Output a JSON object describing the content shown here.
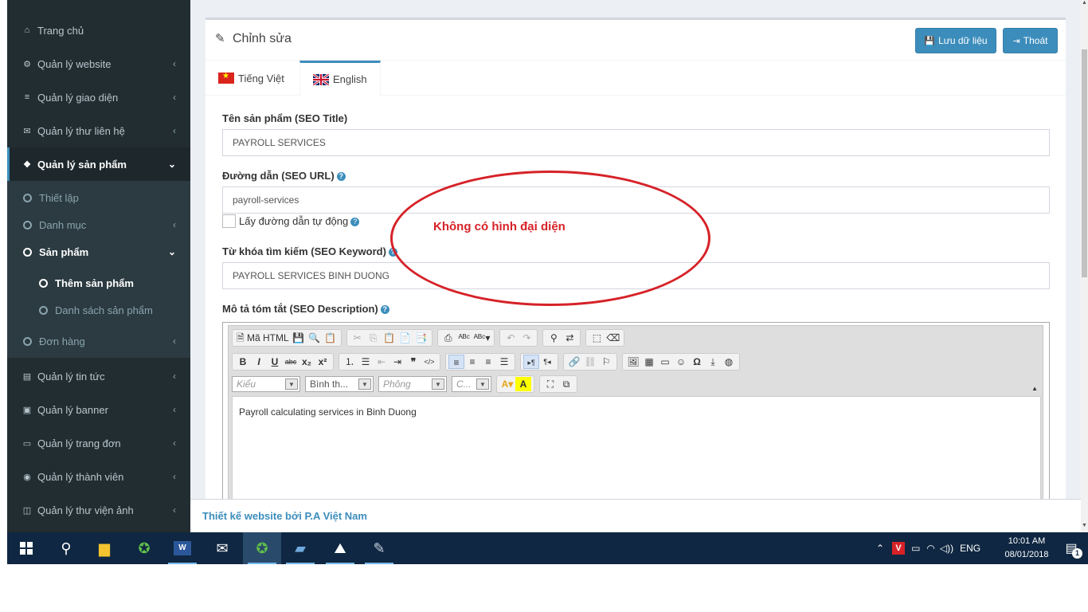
{
  "sidebar": {
    "items": [
      {
        "label": "Trang chủ",
        "icon": "home-icon"
      },
      {
        "label": "Quản lý website",
        "icon": "gears-icon"
      },
      {
        "label": "Quản lý giao diện",
        "icon": "bars-icon"
      },
      {
        "label": "Quản lý thư liên hệ",
        "icon": "envelope-icon"
      },
      {
        "label": "Quản lý sản phẩm",
        "icon": "cubes-icon"
      },
      {
        "label": "Quản lý tin tức",
        "icon": "newspaper-icon"
      },
      {
        "label": "Quản lý banner",
        "icon": "image-icon"
      },
      {
        "label": "Quản lý trang đơn",
        "icon": "laptop-icon"
      },
      {
        "label": "Quản lý thành viên",
        "icon": "user-circle-icon"
      },
      {
        "label": "Quản lý thư viện ảnh",
        "icon": "file-image-icon"
      }
    ],
    "submenu": [
      {
        "label": "Thiết lập"
      },
      {
        "label": "Danh mục"
      },
      {
        "label": "Sản phẩm"
      },
      {
        "label": "Thêm sản phẩm"
      },
      {
        "label": "Danh sách sản phẩm"
      },
      {
        "label": "Đơn hàng"
      }
    ]
  },
  "panel": {
    "title": "Chỉnh sửa",
    "save_label": "Lưu dữ liệu",
    "exit_label": "Thoát"
  },
  "tabs": [
    {
      "label": "Tiếng Việt",
      "icon": "vietnam-flag-icon"
    },
    {
      "label": "English",
      "icon": "uk-flag-icon"
    }
  ],
  "form": {
    "seo_title_label": "Tên sản phẩm (SEO Title)",
    "seo_title_value": "PAYROLL SERVICES",
    "seo_url_label": "Đường dẫn (SEO URL)",
    "seo_url_value": "payroll-services",
    "auto_url_label": "Lấy đường dẫn tự động",
    "seo_keyword_label": "Từ khóa tìm kiếm (SEO Keyword)",
    "seo_keyword_value": "PAYROLL SERVICES BINH DUONG",
    "seo_desc_label": "Mô tả tóm tắt (SEO Description)"
  },
  "editor": {
    "source_label": "Mã HTML",
    "style_combo": "Kiểu",
    "format_combo": "Bình th...",
    "font_combo": "Phông",
    "size_combo": "C...",
    "content": "Payroll calculating services in Binh Duong"
  },
  "annotation": {
    "text": "Không có hình đại diện",
    "color": "#d62228"
  },
  "footer": {
    "text": "Thiết kế website bởi P.A Việt Nam"
  },
  "taskbar": {
    "lang": "ENG",
    "time": "10:01 AM",
    "date": "08/01/2018",
    "notification_count": "1"
  },
  "colors": {
    "sidebar_bg": "#222d32",
    "accent": "#3c8dbc",
    "taskbar_bg": "#0f2742"
  }
}
